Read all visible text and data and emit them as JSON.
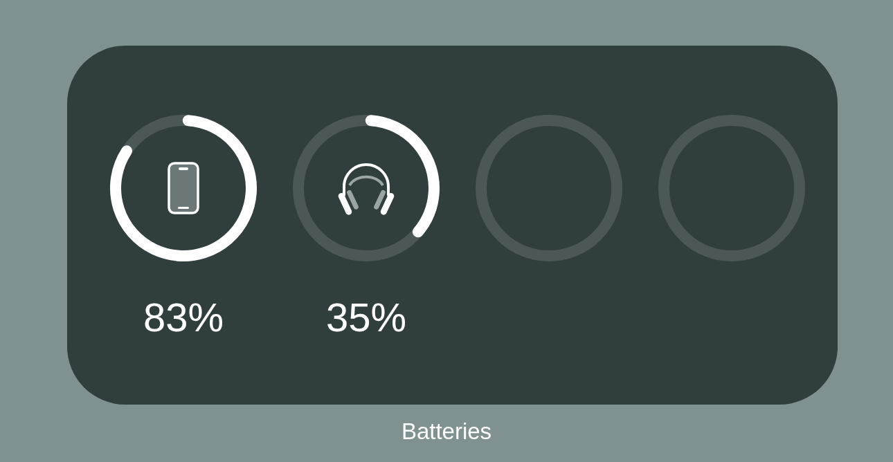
{
  "widget": {
    "devices": [
      {
        "kind": "phone",
        "level": 0.83,
        "reading": "83%"
      },
      {
        "kind": "headphones",
        "level": 0.35,
        "reading": "35%"
      },
      {
        "kind": "empty"
      },
      {
        "kind": "empty"
      }
    ]
  },
  "label": "Batteries"
}
